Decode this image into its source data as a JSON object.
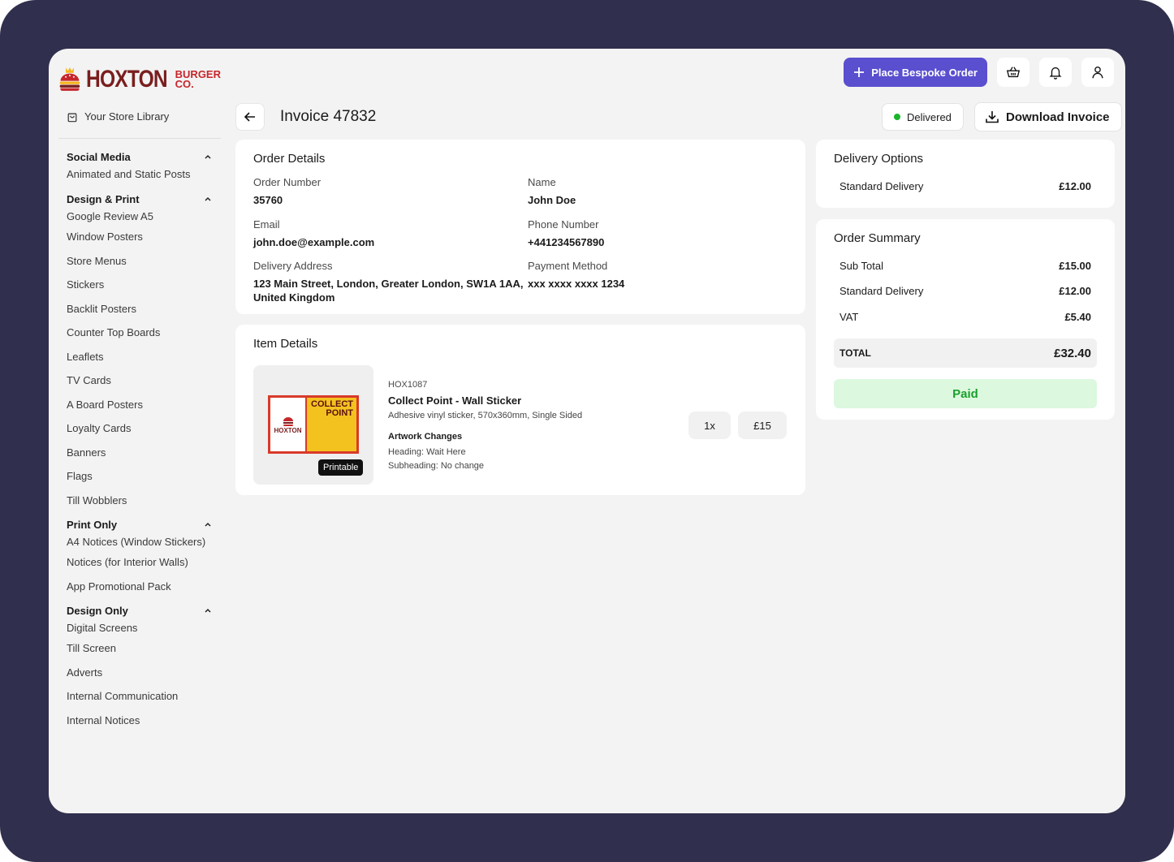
{
  "brand": {
    "name": "HOXTON",
    "sub_line1": "BURGER",
    "sub_line2": "CO."
  },
  "sidebar": {
    "store_library": "Your Store Library",
    "groups": [
      {
        "title": "Social Media",
        "items": [
          "Animated and Static Posts"
        ]
      },
      {
        "title": "Design & Print",
        "items": [
          "Google Review A5",
          "Window Posters",
          "Store Menus",
          "Stickers",
          "Backlit Posters",
          "Counter Top Boards",
          "Leaflets",
          "TV Cards",
          "A Board Posters",
          "Loyalty Cards",
          "Banners",
          "Flags",
          "Till Wobblers"
        ]
      },
      {
        "title": "Print Only",
        "items": [
          "A4 Notices (Window Stickers)",
          "Notices (for Interior Walls)",
          "App Promotional Pack"
        ]
      },
      {
        "title": "Design Only",
        "items": [
          "Digital Screens",
          "Till Screen",
          "Adverts",
          "Internal Communication",
          "Internal Notices"
        ]
      }
    ]
  },
  "topbar": {
    "bespoke_label": "Place Bespoke Order"
  },
  "header": {
    "title": "Invoice 47832",
    "status": "Delivered",
    "download_label": "Download Invoice"
  },
  "order_details": {
    "title": "Order Details",
    "order_number_label": "Order Number",
    "order_number": "35760",
    "name_label": "Name",
    "name": "John Doe",
    "email_label": "Email",
    "email": "john.doe@example.com",
    "phone_label": "Phone Number",
    "phone": "+441234567890",
    "address_label": "Delivery Address",
    "address_line1": "123 Main Street, London, Greater London, SW1A 1AA,",
    "address_line2": "United Kingdom",
    "payment_label": "Payment Method",
    "payment": "xxx xxxx xxxx 1234"
  },
  "item_details": {
    "title": "Item Details",
    "badge": "Printable",
    "sticker_text_1": "COLLECT",
    "sticker_text_2": "POINT",
    "sticker_brand": "HOXTON",
    "sku": "HOX1087",
    "name": "Collect Point - Wall Sticker",
    "description": "Adhesive vinyl sticker, 570x360mm, Single Sided",
    "artwork_title": "Artwork Changes",
    "artwork_heading": "Heading: Wait Here",
    "artwork_subheading": "Subheading: No change",
    "quantity": "1x",
    "price": "£15"
  },
  "delivery_options": {
    "title": "Delivery Options",
    "method": "Standard Delivery",
    "cost": "£12.00"
  },
  "order_summary": {
    "title": "Order Summary",
    "subtotal_label": "Sub Total",
    "subtotal": "£15.00",
    "delivery_label": "Standard Delivery",
    "delivery": "£12.00",
    "vat_label": "VAT",
    "vat": "£5.40",
    "total_label": "TOTAL",
    "total": "£32.40",
    "payment_status": "Paid"
  },
  "colors": {
    "accent": "#5a4fcf",
    "frame": "#302f4d",
    "status_green": "#19b52c",
    "paid_bg": "#dcf8df"
  }
}
